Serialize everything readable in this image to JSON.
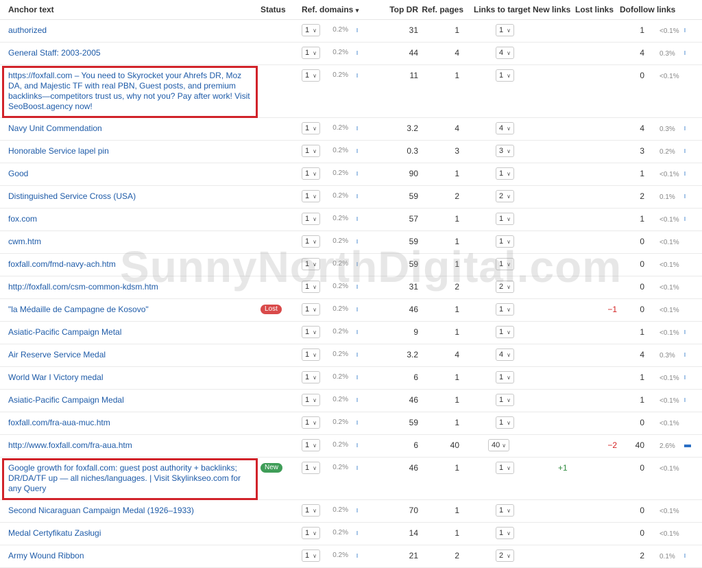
{
  "headers": {
    "anchor_text": "Anchor text",
    "status": "Status",
    "ref_domains": "Ref. domains",
    "ref_domains_sort": "▾",
    "top_dr": "Top DR",
    "ref_pages": "Ref. pages",
    "links_to_target": "Links to target",
    "new_links": "New links",
    "lost_links": "Lost links",
    "dofollow_links": "Dofollow links"
  },
  "rows": [
    {
      "anchor": "authorized",
      "status": "",
      "ref_domains": "1",
      "ref_pct": "0.2%",
      "top_dr": "31",
      "ref_pages": "1",
      "links": "1",
      "new_links": "",
      "lost_links": "",
      "dofollow": "1",
      "dofollow_pct": "<0.1%"
    },
    {
      "anchor": "General Staff: 2003-2005",
      "status": "",
      "ref_domains": "1",
      "ref_pct": "0.2%",
      "top_dr": "44",
      "ref_pages": "4",
      "links": "4",
      "new_links": "",
      "lost_links": "",
      "dofollow": "4",
      "dofollow_pct": "0.3%"
    },
    {
      "anchor": "https://foxfall.com – You need to Skyrocket your Ahrefs DR, Moz DA, and Majestic TF with real PBN, Guest posts, and premium backlinks—competitors trust us, why not you? Pay after work! Visit SeoBoost.agency now!",
      "status": "",
      "ref_domains": "1",
      "ref_pct": "0.2%",
      "top_dr": "11",
      "ref_pages": "1",
      "links": "1",
      "new_links": "",
      "lost_links": "",
      "dofollow": "0",
      "dofollow_pct": "<0.1%"
    },
    {
      "anchor": "Navy Unit Commendation",
      "status": "",
      "ref_domains": "1",
      "ref_pct": "0.2%",
      "top_dr": "3.2",
      "ref_pages": "4",
      "links": "4",
      "new_links": "",
      "lost_links": "",
      "dofollow": "4",
      "dofollow_pct": "0.3%"
    },
    {
      "anchor": "Honorable Service lapel pin",
      "status": "",
      "ref_domains": "1",
      "ref_pct": "0.2%",
      "top_dr": "0.3",
      "ref_pages": "3",
      "links": "3",
      "new_links": "",
      "lost_links": "",
      "dofollow": "3",
      "dofollow_pct": "0.2%"
    },
    {
      "anchor": "Good",
      "status": "",
      "ref_domains": "1",
      "ref_pct": "0.2%",
      "top_dr": "90",
      "ref_pages": "1",
      "links": "1",
      "new_links": "",
      "lost_links": "",
      "dofollow": "1",
      "dofollow_pct": "<0.1%"
    },
    {
      "anchor": "Distinguished Service Cross (USA)",
      "status": "",
      "ref_domains": "1",
      "ref_pct": "0.2%",
      "top_dr": "59",
      "ref_pages": "2",
      "links": "2",
      "new_links": "",
      "lost_links": "",
      "dofollow": "2",
      "dofollow_pct": "0.1%"
    },
    {
      "anchor": "fox.com",
      "status": "",
      "ref_domains": "1",
      "ref_pct": "0.2%",
      "top_dr": "57",
      "ref_pages": "1",
      "links": "1",
      "new_links": "",
      "lost_links": "",
      "dofollow": "1",
      "dofollow_pct": "<0.1%"
    },
    {
      "anchor": "cwm.htm",
      "status": "",
      "ref_domains": "1",
      "ref_pct": "0.2%",
      "top_dr": "59",
      "ref_pages": "1",
      "links": "1",
      "new_links": "",
      "lost_links": "",
      "dofollow": "0",
      "dofollow_pct": "<0.1%"
    },
    {
      "anchor": "foxfall.com/fmd-navy-ach.htm",
      "status": "",
      "ref_domains": "1",
      "ref_pct": "0.2%",
      "top_dr": "59",
      "ref_pages": "1",
      "links": "1",
      "new_links": "",
      "lost_links": "",
      "dofollow": "0",
      "dofollow_pct": "<0.1%"
    },
    {
      "anchor": "http://foxfall.com/csm-common-kdsm.htm",
      "status": "",
      "ref_domains": "1",
      "ref_pct": "0.2%",
      "top_dr": "31",
      "ref_pages": "2",
      "links": "2",
      "new_links": "",
      "lost_links": "",
      "dofollow": "0",
      "dofollow_pct": "<0.1%"
    },
    {
      "anchor": "\"la Médaille de Campagne de Kosovo\"",
      "status": "Lost",
      "ref_domains": "1",
      "ref_pct": "0.2%",
      "top_dr": "46",
      "ref_pages": "1",
      "links": "1",
      "new_links": "",
      "lost_links": "−1",
      "dofollow": "0",
      "dofollow_pct": "<0.1%"
    },
    {
      "anchor": "Asiatic-Pacific Campaign Metal",
      "status": "",
      "ref_domains": "1",
      "ref_pct": "0.2%",
      "top_dr": "9",
      "ref_pages": "1",
      "links": "1",
      "new_links": "",
      "lost_links": "",
      "dofollow": "1",
      "dofollow_pct": "<0.1%"
    },
    {
      "anchor": "Air Reserve Service Medal",
      "status": "",
      "ref_domains": "1",
      "ref_pct": "0.2%",
      "top_dr": "3.2",
      "ref_pages": "4",
      "links": "4",
      "new_links": "",
      "lost_links": "",
      "dofollow": "4",
      "dofollow_pct": "0.3%"
    },
    {
      "anchor": "World War I Victory medal",
      "status": "",
      "ref_domains": "1",
      "ref_pct": "0.2%",
      "top_dr": "6",
      "ref_pages": "1",
      "links": "1",
      "new_links": "",
      "lost_links": "",
      "dofollow": "1",
      "dofollow_pct": "<0.1%"
    },
    {
      "anchor": "Asiatic-Pacific Campaign Medal",
      "status": "",
      "ref_domains": "1",
      "ref_pct": "0.2%",
      "top_dr": "46",
      "ref_pages": "1",
      "links": "1",
      "new_links": "",
      "lost_links": "",
      "dofollow": "1",
      "dofollow_pct": "<0.1%"
    },
    {
      "anchor": "foxfall.com/fra-aua-muc.htm",
      "status": "",
      "ref_domains": "1",
      "ref_pct": "0.2%",
      "top_dr": "59",
      "ref_pages": "1",
      "links": "1",
      "new_links": "",
      "lost_links": "",
      "dofollow": "0",
      "dofollow_pct": "<0.1%"
    },
    {
      "anchor": "http://www.foxfall.com/fra-aua.htm",
      "status": "",
      "ref_domains": "1",
      "ref_pct": "0.2%",
      "top_dr": "6",
      "ref_pages": "40",
      "links": "40",
      "new_links": "",
      "lost_links": "−2",
      "dofollow": "40",
      "dofollow_pct": "2.6%"
    },
    {
      "anchor": "Google growth for foxfall.com: guest post authority + backlinks; DR/DA/TF up — all niches/languages. | Visit Skylinkseo.com for any Query",
      "status": "New",
      "ref_domains": "1",
      "ref_pct": "0.2%",
      "top_dr": "46",
      "ref_pages": "1",
      "links": "1",
      "new_links": "+1",
      "lost_links": "",
      "dofollow": "0",
      "dofollow_pct": "<0.1%"
    },
    {
      "anchor": "Second Nicaraguan Campaign Medal (1926–1933)",
      "status": "",
      "ref_domains": "1",
      "ref_pct": "0.2%",
      "top_dr": "70",
      "ref_pages": "1",
      "links": "1",
      "new_links": "",
      "lost_links": "",
      "dofollow": "0",
      "dofollow_pct": "<0.1%"
    },
    {
      "anchor": "Medal Certyfikatu Zasługi",
      "status": "",
      "ref_domains": "1",
      "ref_pct": "0.2%",
      "top_dr": "14",
      "ref_pages": "1",
      "links": "1",
      "new_links": "",
      "lost_links": "",
      "dofollow": "0",
      "dofollow_pct": "<0.1%"
    },
    {
      "anchor": "Army Wound Ribbon",
      "status": "",
      "ref_domains": "1",
      "ref_pct": "0.2%",
      "top_dr": "21",
      "ref_pages": "2",
      "links": "2",
      "new_links": "",
      "lost_links": "",
      "dofollow": "2",
      "dofollow_pct": "0.1%"
    }
  ],
  "watermark": "SunnyNorthDigital.com",
  "colors": {
    "link": "#1e5ba8",
    "lost_badge": "#d94a4a",
    "new_badge": "#3f9d58",
    "highlight": "#d1232a",
    "negative": "#d42222",
    "positive": "#2e8b3e"
  }
}
